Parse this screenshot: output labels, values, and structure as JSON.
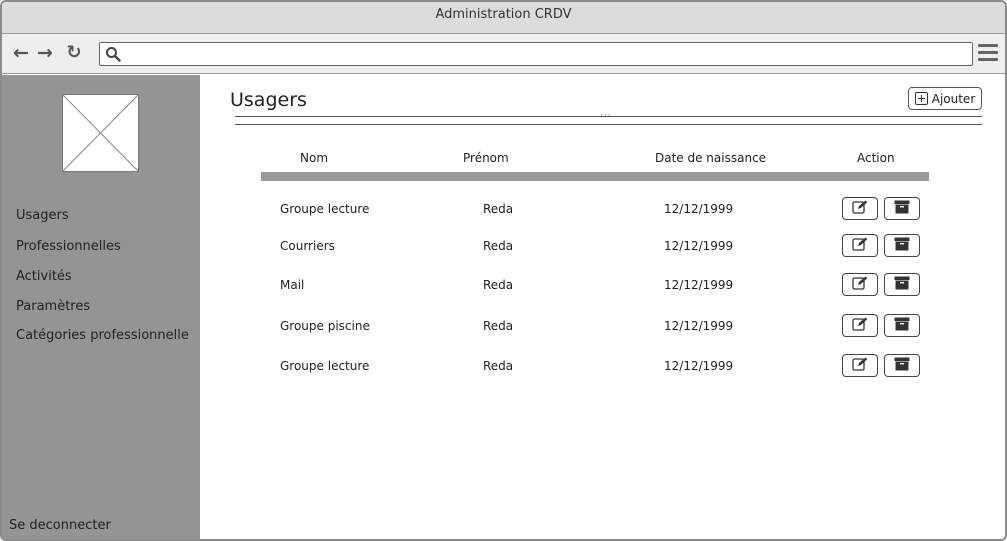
{
  "window": {
    "title": "Administration CRDV"
  },
  "browser": {
    "back_icon": "arrow-left-icon",
    "forward_icon": "arrow-right-icon",
    "reload_icon": "reload-icon",
    "search_icon": "search-icon",
    "menu_icon": "hamburger-menu-icon",
    "url": ""
  },
  "sidebar": {
    "logo": "image-placeholder",
    "items": [
      {
        "label": "Usagers"
      },
      {
        "label": "Professionnelles"
      },
      {
        "label": "Activités"
      },
      {
        "label": "Paramètres"
      },
      {
        "label": "Catégories professionnelle"
      }
    ],
    "logout_label": "Se deconnecter"
  },
  "main": {
    "title": "Usagers",
    "add_label": "Ajouter",
    "add_icon": "plus-square-icon",
    "table": {
      "columns": [
        "Nom",
        "Prénom",
        "Date de naissance",
        "Action"
      ],
      "rows": [
        {
          "nom": "Groupe lecture",
          "prenom": "Reda",
          "date": "12/12/1999"
        },
        {
          "nom": "Courriers",
          "prenom": "Reda",
          "date": "12/12/1999"
        },
        {
          "nom": "Mail",
          "prenom": "Reda",
          "date": "12/12/1999"
        },
        {
          "nom": "Groupe piscine",
          "prenom": "Reda",
          "date": "12/12/1999"
        },
        {
          "nom": "Groupe lecture",
          "prenom": "Reda",
          "date": "12/12/1999"
        }
      ],
      "row_actions": [
        "edit-icon",
        "archive-icon"
      ]
    }
  }
}
